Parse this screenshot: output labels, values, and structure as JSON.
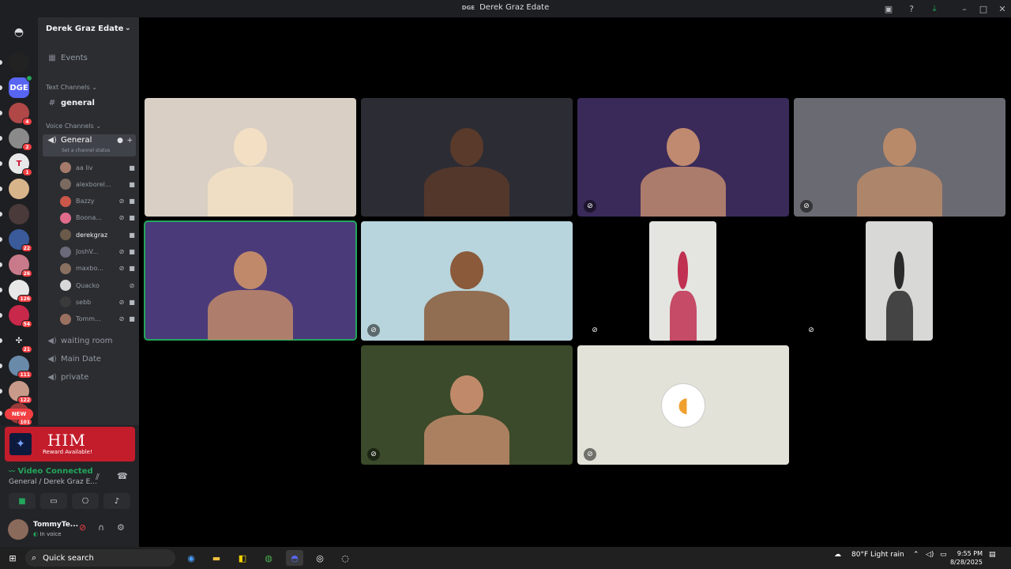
{
  "window": {
    "tag": "DGE",
    "title": "Derek Graz Edate"
  },
  "guild": {
    "name": "Derek Graz Edate"
  },
  "sidebar": {
    "events_label": "Events",
    "text_category": "Text Channels",
    "text_channels": [
      {
        "label": "general"
      }
    ],
    "voice_category": "Voice Channels",
    "active_voice": {
      "label": "General",
      "status_placeholder": "Set a channel status"
    },
    "members": [
      {
        "name": "aa liv",
        "color": "#a57a6a",
        "icons": [
          "■"
        ]
      },
      {
        "name": "alexborel...",
        "color": "#7b6a5f",
        "icons": [
          "■"
        ]
      },
      {
        "name": "Bazzy",
        "color": "#c9574a",
        "icons": [
          "⊘",
          "■"
        ]
      },
      {
        "name": "Boona...",
        "color": "#e06b8a",
        "icons": [
          "⊘",
          "■"
        ]
      },
      {
        "name": "derekgraz",
        "color": "#6b5a4a",
        "icons": [
          "■"
        ]
      },
      {
        "name": "JoshV...",
        "color": "#6a6a7a",
        "icons": [
          "⊘",
          "■"
        ]
      },
      {
        "name": "maxbo...",
        "color": "#8a7060",
        "icons": [
          "⊘",
          "■"
        ]
      },
      {
        "name": "Quacko",
        "color": "#d8d8d8",
        "icons": [
          "⊘"
        ]
      },
      {
        "name": "sebb",
        "color": "#3a3a3a",
        "icons": [
          "⊘",
          "■"
        ]
      },
      {
        "name": "Tomm...",
        "color": "#9a7060",
        "icons": [
          "⊘",
          "■"
        ]
      }
    ],
    "other_voice": [
      {
        "label": "waiting room"
      },
      {
        "label": "Main Date"
      },
      {
        "label": "private"
      }
    ]
  },
  "servers": [
    {
      "badge": "",
      "color": "#222222"
    },
    {
      "badge": "",
      "color": "#5865f2",
      "label": "DGE"
    },
    {
      "badge": "4",
      "color": "#b04848"
    },
    {
      "badge": "2",
      "color": "#8a8a8a"
    },
    {
      "badge": "1",
      "color": "#e8e8e8",
      "label": "T"
    },
    {
      "badge": "",
      "color": "#d8b48a"
    },
    {
      "badge": "",
      "color": "#4a3a3a"
    },
    {
      "badge": "22",
      "color": "#3a5a9a"
    },
    {
      "badge": "26",
      "color": "#c87a8a"
    },
    {
      "badge": "126",
      "color": "#e8e8e8"
    },
    {
      "badge": "54",
      "color": "#c8284a"
    },
    {
      "badge": "21",
      "color": "#1e1f22",
      "label": "✣"
    },
    {
      "badge": "111",
      "color": "#6a8aaa"
    },
    {
      "badge": "122",
      "color": "#c89a8a"
    },
    {
      "badge": "101",
      "color": "#9a3a3a"
    }
  ],
  "new_label": "NEW",
  "promo": {
    "title": "HIM",
    "subtitle": "Reward Available!"
  },
  "connection": {
    "status": "Video Connected",
    "location": "General / Derek Graz E..."
  },
  "user": {
    "name": "TommyTe...",
    "status": "In voice"
  },
  "tiles": [
    {
      "name": "tile-1",
      "bg": "#d9cfc4",
      "accent": "#f3e0c4",
      "muted": false,
      "speaking": false
    },
    {
      "name": "tile-2",
      "bg": "#2c2c34",
      "accent": "#5a3a2a",
      "muted": false,
      "speaking": false
    },
    {
      "name": "tile-3",
      "bg": "#3a2a5a",
      "accent": "#c08a70",
      "muted": true,
      "speaking": false
    },
    {
      "name": "tile-4",
      "bg": "#6a6a72",
      "accent": "#b88a6a",
      "muted": true,
      "speaking": false
    },
    {
      "name": "tile-5",
      "bg": "#4a3a7a",
      "accent": "#c08a6a",
      "muted": false,
      "speaking": true
    },
    {
      "name": "tile-6",
      "bg": "#b8d4dc",
      "accent": "#8a5a3a",
      "muted": true,
      "speaking": false
    },
    {
      "name": "tile-7",
      "bg": "#e4e4e0",
      "accent": "#c03050",
      "muted": true,
      "speaking": false
    },
    {
      "name": "tile-8",
      "bg": "#d8d8d6",
      "accent": "#2a2a2a",
      "muted": true,
      "speaking": false
    },
    {
      "name": "tile-9",
      "bg": "#3a4a2a",
      "accent": "#c08a6a",
      "muted": true,
      "speaking": false
    },
    {
      "name": "tile-10",
      "bg": "#e2e2d8",
      "accent": "#ffffff",
      "muted": true,
      "speaking": false
    }
  ],
  "taskbar": {
    "search_label": "Quick search",
    "weather": "80°F  Light rain",
    "time": "9:55 PM",
    "date": "8/28/2025"
  },
  "colors": {
    "online": "#23a55a",
    "mention": "#f23f43",
    "blurple": "#5865f2"
  }
}
